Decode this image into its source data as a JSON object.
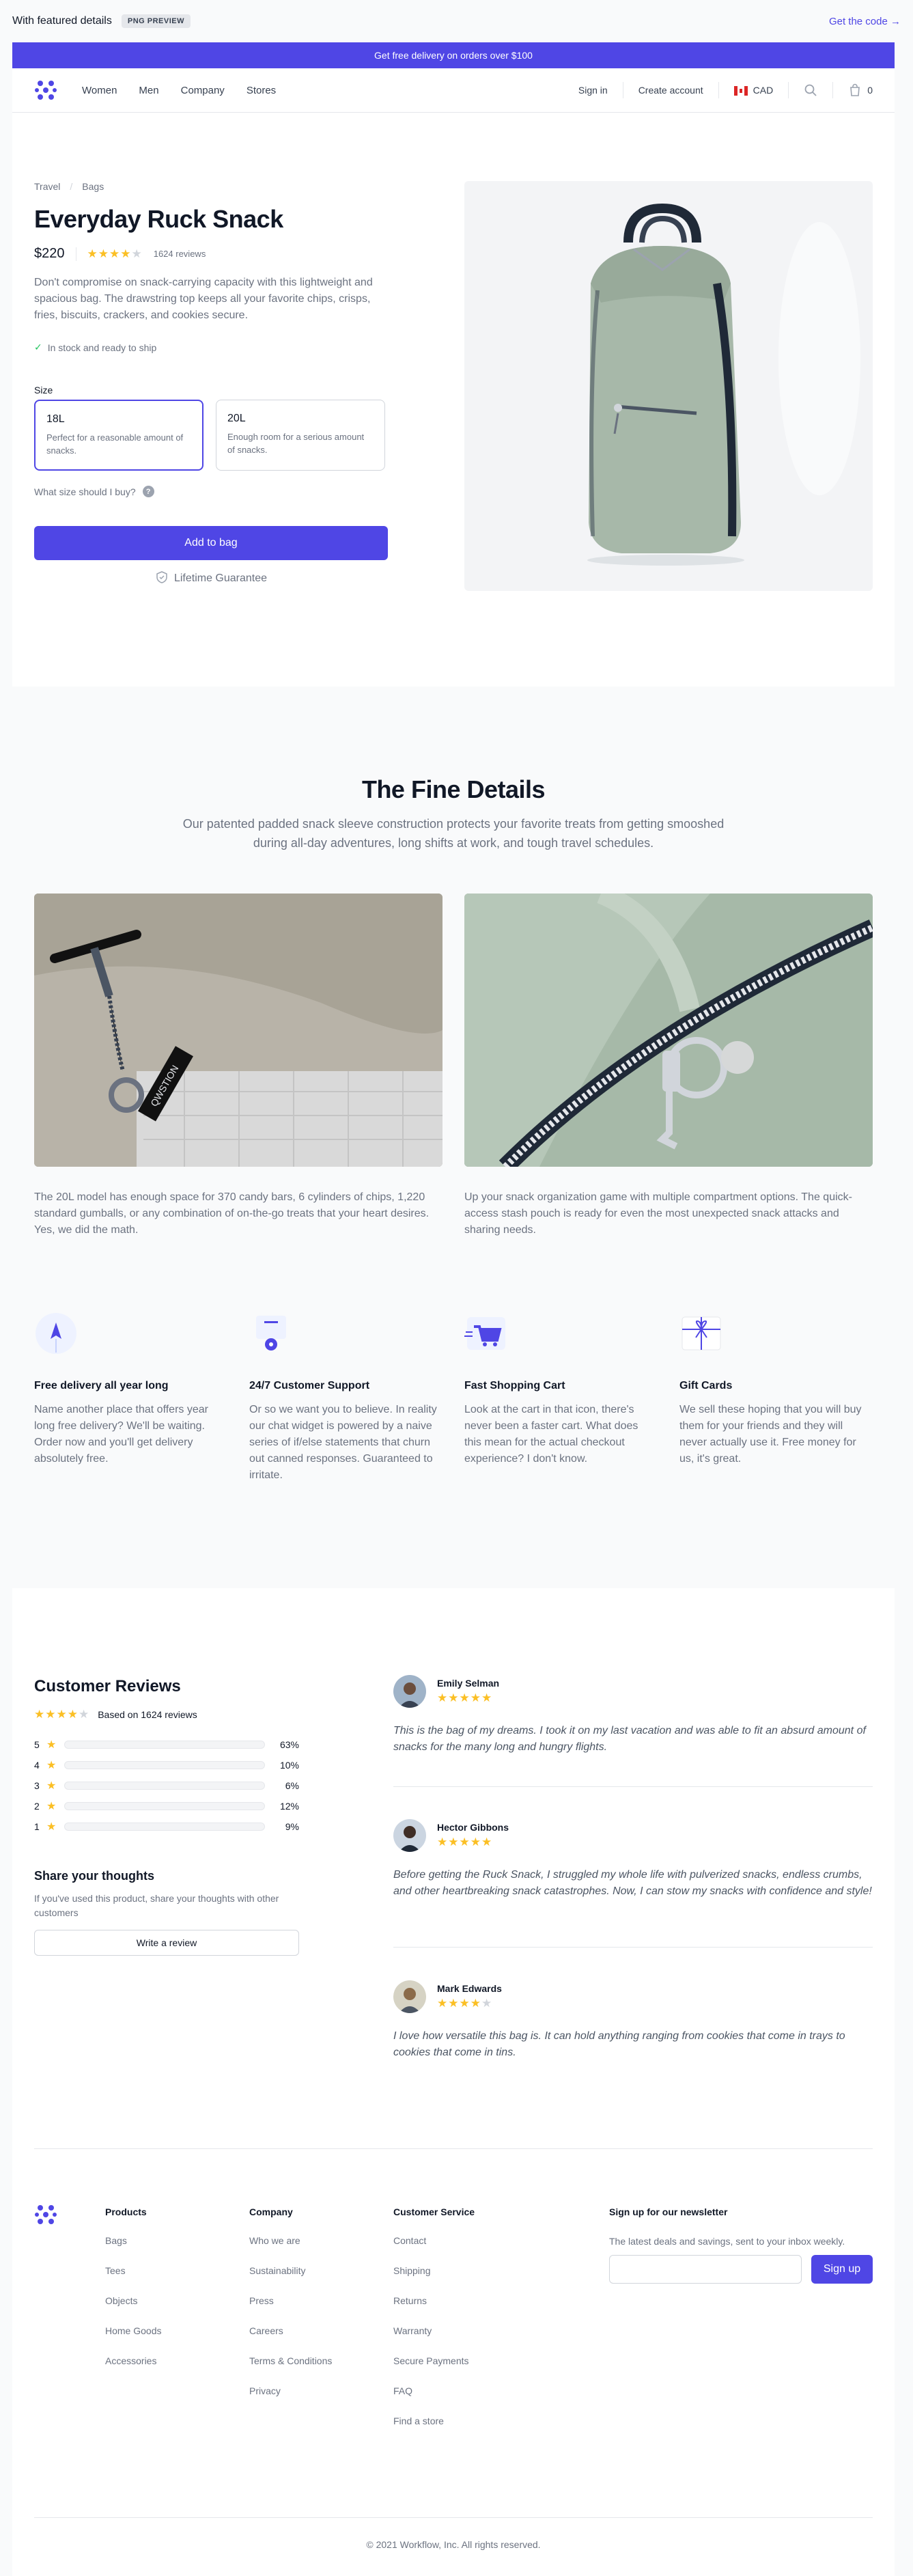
{
  "topbar": {
    "title": "With featured details",
    "badge": "PNG PREVIEW",
    "get_code": "Get the code →"
  },
  "promo": {
    "text": "Get free delivery on orders over $100"
  },
  "nav": {
    "links": [
      "Women",
      "Men",
      "Company",
      "Stores"
    ],
    "sign_in": "Sign in",
    "create_account": "Create account",
    "currency": "CAD",
    "cart_count": "0"
  },
  "product": {
    "breadcrumbs": [
      "Travel",
      "Bags"
    ],
    "breadcrumb_sep": "/",
    "title": "Everyday Ruck Snack",
    "price": "$220",
    "rating": 4,
    "reviews_label": "1624 reviews",
    "description": "Don't compromise on snack-carrying capacity with this lightweight and spacious bag. The drawstring top keeps all your favorite chips, crisps, fries, biscuits, crackers, and cookies secure.",
    "stock": "In stock and ready to ship",
    "size_label": "Size",
    "sizes": [
      {
        "name": "18L",
        "desc": "Perfect for a reasonable amount of snacks."
      },
      {
        "name": "20L",
        "desc": "Enough room for a serious amount of snacks."
      }
    ],
    "size_help": "What size should I buy?",
    "add_to_bag": "Add to bag",
    "guarantee": "Lifetime Guarantee"
  },
  "details": {
    "title": "The Fine Details",
    "subtitle": "Our patented padded snack sleeve construction protects your favorite treats from getting smooshed during all-day adventures, long shifts at work, and tough travel schedules.",
    "items": [
      {
        "text": "The 20L model has enough space for 370 candy bars, 6 cylinders of chips, 1,220 standard gumballs, or any combination of on-the-go treats that your heart desires. Yes, we did the math."
      },
      {
        "text": "Up your snack organization game with multiple compartment options. The quick-access stash pouch is ready for even the most unexpected snack attacks and sharing needs."
      }
    ],
    "tag_text": "QWSTION",
    "features": [
      {
        "title": "Free delivery all year long",
        "text": "Name another place that offers year long free delivery? We'll be waiting. Order now and you'll get delivery absolutely free."
      },
      {
        "title": "24/7 Customer Support",
        "text": "Or so we want you to believe. In reality our chat widget is powered by a naive series of if/else statements that churn out canned responses. Guaranteed to irritate."
      },
      {
        "title": "Fast Shopping Cart",
        "text": "Look at the cart in that icon, there's never been a faster cart. What does this mean for the actual checkout experience? I don't know."
      },
      {
        "title": "Gift Cards",
        "text": "We sell these hoping that you will buy them for your friends and they will never actually use it. Free money for us, it's great."
      }
    ]
  },
  "reviews": {
    "title": "Customer Reviews",
    "rating": 4,
    "based_on": "Based on 1624 reviews",
    "distribution": [
      {
        "stars": "5",
        "percent": 63,
        "label": "63%"
      },
      {
        "stars": "4",
        "percent": 10,
        "label": "10%"
      },
      {
        "stars": "3",
        "percent": 6,
        "label": "6%"
      },
      {
        "stars": "2",
        "percent": 12,
        "label": "12%"
      },
      {
        "stars": "1",
        "percent": 9,
        "label": "9%"
      }
    ],
    "share_title": "Share your thoughts",
    "share_text": "If you've used this product, share your thoughts with other customers",
    "write_button": "Write a review",
    "items": [
      {
        "author": "Emily Selman",
        "rating": 5,
        "text": "This is the bag of my dreams. I took it on my last vacation and was able to fit an absurd amount of snacks for the many long and hungry flights."
      },
      {
        "author": "Hector Gibbons",
        "rating": 5,
        "text": "Before getting the Ruck Snack, I struggled my whole life with pulverized snacks, endless crumbs, and other heartbreaking snack catastrophes. Now, I can stow my snacks with confidence and style!"
      },
      {
        "author": "Mark Edwards",
        "rating": 4,
        "text": "I love how versatile this bag is. It can hold anything ranging from cookies that come in trays to cookies that come in tins."
      }
    ]
  },
  "footer": {
    "columns": [
      {
        "title": "Products",
        "items": [
          "Bags",
          "Tees",
          "Objects",
          "Home Goods",
          "Accessories"
        ]
      },
      {
        "title": "Company",
        "items": [
          "Who we are",
          "Sustainability",
          "Press",
          "Careers",
          "Terms & Conditions",
          "Privacy"
        ]
      },
      {
        "title": "Customer Service",
        "items": [
          "Contact",
          "Shipping",
          "Returns",
          "Warranty",
          "Secure Payments",
          "FAQ",
          "Find a store"
        ]
      }
    ],
    "newsletter_title": "Sign up for our newsletter",
    "newsletter_text": "The latest deals and savings, sent to your inbox weekly.",
    "signup": "Sign up",
    "copyright": "© 2021 Workflow, Inc. All rights reserved."
  },
  "colors": {
    "accent": "#4f46e5",
    "star": "#fbbf24",
    "muted": "#6b7280"
  }
}
